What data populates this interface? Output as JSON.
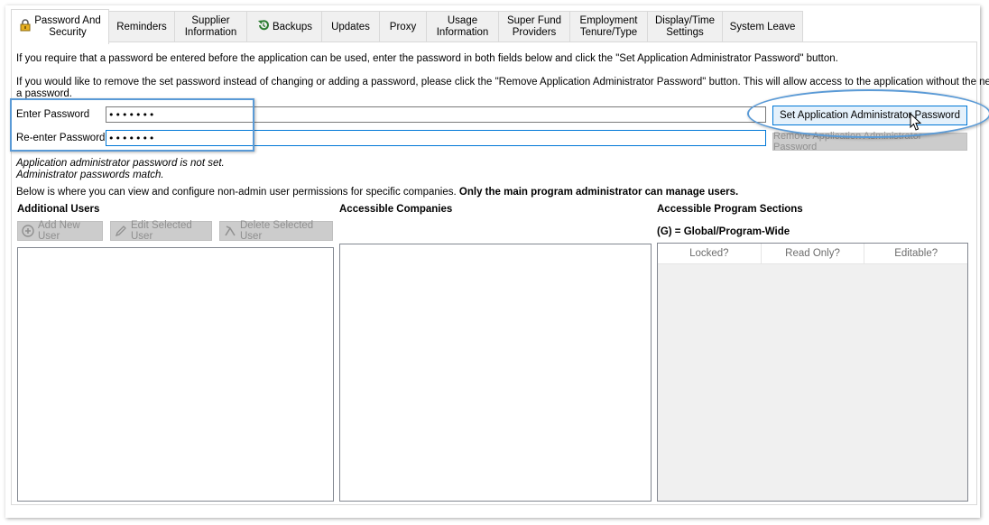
{
  "tabs": [
    {
      "label": "Password And\nSecurity",
      "icon": "lock-icon",
      "active": true
    },
    {
      "label": "Reminders"
    },
    {
      "label": "Supplier\nInformation"
    },
    {
      "label": "Backups",
      "icon": "backup-restore-icon"
    },
    {
      "label": "Updates"
    },
    {
      "label": "Proxy"
    },
    {
      "label": "Usage\nInformation"
    },
    {
      "label": "Super Fund\nProviders"
    },
    {
      "label": "Employment\nTenure/Type"
    },
    {
      "label": "Display/Time\nSettings"
    },
    {
      "label": "System Leave"
    }
  ],
  "password": {
    "intro1": "If you require that a password be entered before the application can be used, enter the password in both fields below and click the \"Set Application Administrator Password\" button.",
    "intro2": "If you would like to remove the set password instead of changing or adding a password, please click the \"Remove Application Administrator Password\" button. This will allow access to the application without the need for",
    "intro2b": "a password.",
    "enter_label": "Enter Password",
    "enter_value": "•••••••",
    "reenter_label": "Re-enter Password",
    "reenter_value": "•••••••",
    "set_button": "Set Application Administrator Password",
    "remove_button": "Remove Application Administrator Password",
    "status1": "Application administrator password is not set.",
    "status2": "Administrator passwords match."
  },
  "users": {
    "info_normal": "Below is where you can view and configure non-admin user permissions for specific companies. ",
    "info_bold": "Only the main program administrator can manage users.",
    "additional_users": "Additional Users",
    "add_button": "Add New User",
    "edit_button": "Edit Selected User",
    "delete_button": "Delete Selected User",
    "accessible_companies": "Accessible Companies",
    "accessible_sections": "Accessible Program Sections",
    "global_note": "(G) = Global/Program-Wide",
    "columns": [
      "Locked?",
      "Read Only?",
      "Editable?"
    ]
  },
  "colors": {
    "accent": "#0078d7",
    "highlight": "#5a9ad6",
    "lock": "#e8b020",
    "backup": "#2e7d32"
  }
}
